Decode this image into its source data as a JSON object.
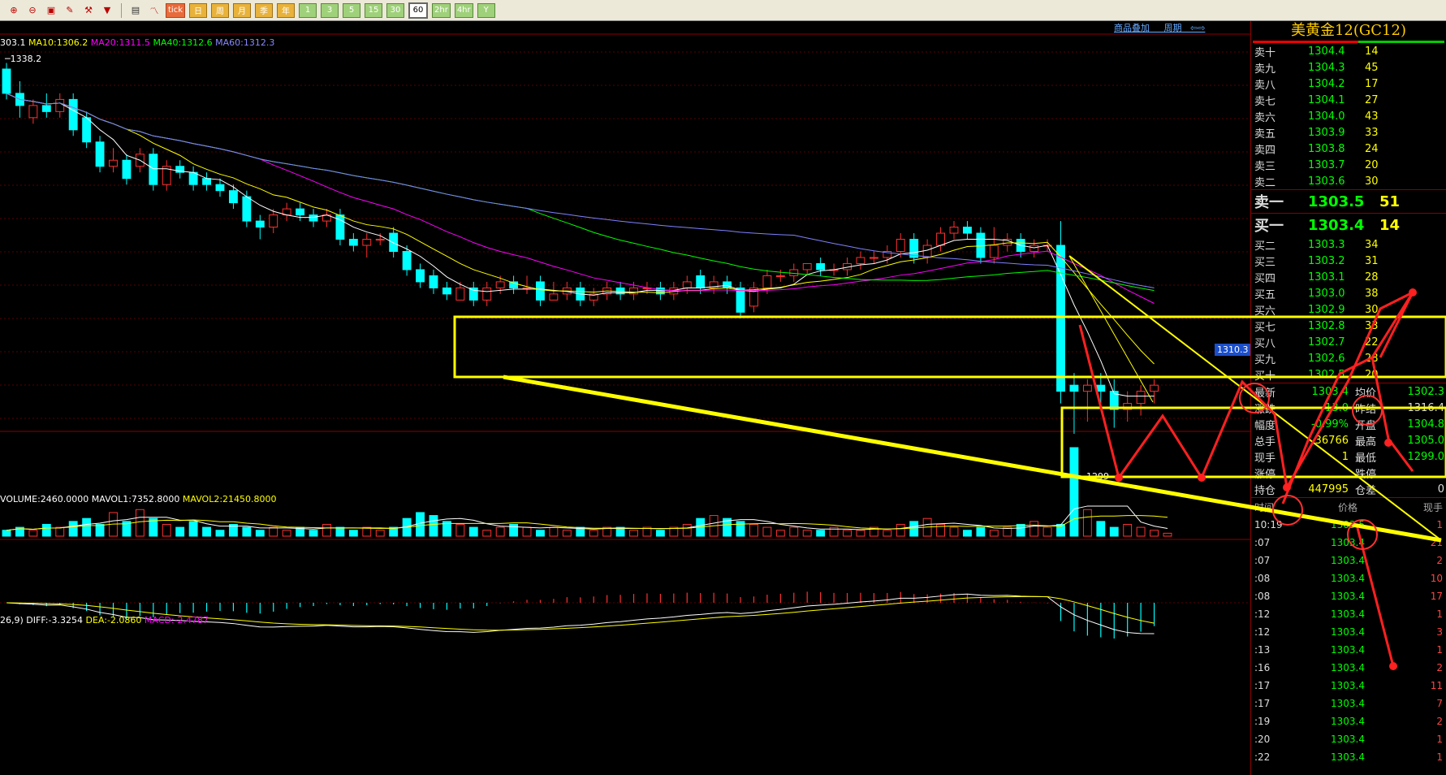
{
  "toolbar": {
    "buttons": [
      "1",
      "3",
      "5",
      "15",
      "30",
      "60",
      "2hr",
      "4hr",
      "Y"
    ],
    "active": "60",
    "icons": [
      "zoom-in-icon",
      "zoom-out-icon",
      "window-icon",
      "pencil-icon",
      "tools-icon",
      "filter-icon",
      "table-icon",
      "line-chart-icon",
      "tick-icon",
      "day-icon",
      "week-icon",
      "month-icon",
      "season-icon",
      "year-icon"
    ],
    "small_btn_labels": [
      "tick",
      "日",
      "周",
      "月",
      "季",
      "年"
    ]
  },
  "chart": {
    "ma_line": {
      "prefix": "303.1",
      "ma10": "MA10:1306.2",
      "ma20": "MA20:1311.5",
      "ma40": "MA40:1312.6",
      "ma60": "MA60:1312.3"
    },
    "high_label": "1338.2",
    "low_label": "1299",
    "links": [
      "商品叠加",
      "周期"
    ],
    "current_price_tag": "1310.3",
    "volume_line": {
      "volume": "VOLUME:2460.0000",
      "mavol1": "MAVOL1:7352.8000",
      "mavol2": "MAVOL2:21450.8000"
    },
    "macd_line": {
      "params": "26,9)",
      "diff": "DIFF:-3.3254",
      "dea": "DEA:-2.0860",
      "macd": "MACD:-2.4787"
    },
    "colors": {
      "up": "#ff3030",
      "down": "#00ffff",
      "ma5": "#ffffff",
      "ma10": "#ffff00",
      "ma20": "#ff00ff",
      "ma40": "#00ff00",
      "ma60": "#8080ff"
    }
  },
  "chart_data": {
    "type": "candlestick",
    "price_range": [
      1295,
      1340
    ],
    "candles": [
      {
        "o": 1338,
        "c": 1334,
        "h": 1339,
        "l": 1333
      },
      {
        "o": 1334,
        "c": 1332,
        "h": 1336,
        "l": 1330
      },
      {
        "o": 1330,
        "c": 1332,
        "h": 1333,
        "l": 1329
      },
      {
        "o": 1332,
        "c": 1331,
        "h": 1334,
        "l": 1330
      },
      {
        "o": 1331,
        "c": 1333,
        "h": 1334,
        "l": 1330
      },
      {
        "o": 1333,
        "c": 1328,
        "h": 1334,
        "l": 1327
      },
      {
        "o": 1330,
        "c": 1326,
        "h": 1331,
        "l": 1325
      },
      {
        "o": 1326,
        "c": 1322,
        "h": 1327,
        "l": 1321
      },
      {
        "o": 1322,
        "c": 1323,
        "h": 1325,
        "l": 1321
      },
      {
        "o": 1323,
        "c": 1320,
        "h": 1324,
        "l": 1319
      },
      {
        "o": 1322,
        "c": 1324,
        "h": 1325,
        "l": 1321
      },
      {
        "o": 1324,
        "c": 1319,
        "h": 1325,
        "l": 1318
      },
      {
        "o": 1319,
        "c": 1322,
        "h": 1323,
        "l": 1318
      },
      {
        "o": 1322,
        "c": 1321,
        "h": 1323,
        "l": 1320
      },
      {
        "o": 1321,
        "c": 1319,
        "h": 1322,
        "l": 1318
      },
      {
        "o": 1320,
        "c": 1319,
        "h": 1321,
        "l": 1318
      },
      {
        "o": 1319,
        "c": 1318,
        "h": 1320,
        "l": 1317
      },
      {
        "o": 1318,
        "c": 1316,
        "h": 1319,
        "l": 1315
      },
      {
        "o": 1317,
        "c": 1313,
        "h": 1318,
        "l": 1312
      },
      {
        "o": 1313,
        "c": 1312,
        "h": 1314,
        "l": 1310
      },
      {
        "o": 1312,
        "c": 1314,
        "h": 1315,
        "l": 1311
      },
      {
        "o": 1314,
        "c": 1315,
        "h": 1316,
        "l": 1313
      },
      {
        "o": 1315,
        "c": 1314,
        "h": 1316,
        "l": 1313
      },
      {
        "o": 1314,
        "c": 1313,
        "h": 1315,
        "l": 1312
      },
      {
        "o": 1313,
        "c": 1314,
        "h": 1315,
        "l": 1312
      },
      {
        "o": 1314,
        "c": 1310,
        "h": 1315,
        "l": 1309
      },
      {
        "o": 1310,
        "c": 1309,
        "h": 1311,
        "l": 1308
      },
      {
        "o": 1309,
        "c": 1310,
        "h": 1311,
        "l": 1307
      },
      {
        "o": 1310,
        "c": 1310,
        "h": 1311,
        "l": 1309
      },
      {
        "o": 1311,
        "c": 1308,
        "h": 1312,
        "l": 1307
      },
      {
        "o": 1308,
        "c": 1305,
        "h": 1309,
        "l": 1304
      },
      {
        "o": 1305,
        "c": 1303,
        "h": 1306,
        "l": 1302
      },
      {
        "o": 1304,
        "c": 1302,
        "h": 1305,
        "l": 1301
      },
      {
        "o": 1302,
        "c": 1301,
        "h": 1303,
        "l": 1300
      },
      {
        "o": 1300,
        "c": 1302,
        "h": 1303,
        "l": 1300
      },
      {
        "o": 1302,
        "c": 1300,
        "h": 1303,
        "l": 1299
      },
      {
        "o": 1300,
        "c": 1302,
        "h": 1303,
        "l": 1299
      },
      {
        "o": 1302,
        "c": 1303,
        "h": 1304,
        "l": 1301
      },
      {
        "o": 1303,
        "c": 1302,
        "h": 1304,
        "l": 1301
      },
      {
        "o": 1302,
        "c": 1302,
        "h": 1304,
        "l": 1301
      },
      {
        "o": 1303,
        "c": 1300,
        "h": 1304,
        "l": 1299
      },
      {
        "o": 1300,
        "c": 1301,
        "h": 1303,
        "l": 1300
      },
      {
        "o": 1301,
        "c": 1302,
        "h": 1303,
        "l": 1300
      },
      {
        "o": 1302,
        "c": 1300,
        "h": 1303,
        "l": 1299
      },
      {
        "o": 1300,
        "c": 1301,
        "h": 1302,
        "l": 1299
      },
      {
        "o": 1301,
        "c": 1302,
        "h": 1303,
        "l": 1300
      },
      {
        "o": 1302,
        "c": 1301,
        "h": 1303,
        "l": 1300
      },
      {
        "o": 1301,
        "c": 1302,
        "h": 1303,
        "l": 1300
      },
      {
        "o": 1302,
        "c": 1302,
        "h": 1303,
        "l": 1301
      },
      {
        "o": 1302,
        "c": 1301,
        "h": 1303,
        "l": 1300
      },
      {
        "o": 1301,
        "c": 1302,
        "h": 1303,
        "l": 1300
      },
      {
        "o": 1302,
        "c": 1303,
        "h": 1304,
        "l": 1301
      },
      {
        "o": 1304,
        "c": 1302,
        "h": 1305,
        "l": 1301
      },
      {
        "o": 1302,
        "c": 1303,
        "h": 1304,
        "l": 1301
      },
      {
        "o": 1303,
        "c": 1302,
        "h": 1304,
        "l": 1301
      },
      {
        "o": 1302,
        "c": 1298,
        "h": 1303,
        "l": 1297
      },
      {
        "o": 1299,
        "c": 1302,
        "h": 1303,
        "l": 1298
      },
      {
        "o": 1302,
        "c": 1304,
        "h": 1305,
        "l": 1301
      },
      {
        "o": 1304,
        "c": 1304,
        "h": 1305,
        "l": 1303
      },
      {
        "o": 1304,
        "c": 1305,
        "h": 1306,
        "l": 1303
      },
      {
        "o": 1305,
        "c": 1306,
        "h": 1306,
        "l": 1304
      },
      {
        "o": 1306,
        "c": 1305,
        "h": 1307,
        "l": 1304
      },
      {
        "o": 1305,
        "c": 1305,
        "h": 1306,
        "l": 1304
      },
      {
        "o": 1305,
        "c": 1306,
        "h": 1307,
        "l": 1304
      },
      {
        "o": 1306,
        "c": 1307,
        "h": 1308,
        "l": 1305
      },
      {
        "o": 1307,
        "c": 1307,
        "h": 1308,
        "l": 1306
      },
      {
        "o": 1307,
        "c": 1308,
        "h": 1309,
        "l": 1306
      },
      {
        "o": 1308,
        "c": 1310,
        "h": 1311,
        "l": 1307
      },
      {
        "o": 1310,
        "c": 1307,
        "h": 1311,
        "l": 1306
      },
      {
        "o": 1307,
        "c": 1309,
        "h": 1310,
        "l": 1306
      },
      {
        "o": 1309,
        "c": 1311,
        "h": 1312,
        "l": 1308
      },
      {
        "o": 1311,
        "c": 1312,
        "h": 1313,
        "l": 1310
      },
      {
        "o": 1312,
        "c": 1311,
        "h": 1313,
        "l": 1310
      },
      {
        "o": 1311,
        "c": 1307,
        "h": 1312,
        "l": 1306
      },
      {
        "o": 1307,
        "c": 1309,
        "h": 1312,
        "l": 1306
      },
      {
        "o": 1309,
        "c": 1310,
        "h": 1311,
        "l": 1308
      },
      {
        "o": 1310,
        "c": 1308,
        "h": 1311,
        "l": 1307
      },
      {
        "o": 1308,
        "c": 1309,
        "h": 1310,
        "l": 1307
      },
      {
        "o": 1309,
        "c": 1309,
        "h": 1310,
        "l": 1308
      },
      {
        "o": 1309,
        "c": 1285,
        "h": 1313,
        "l": 1283
      },
      {
        "o": 1286,
        "c": 1285,
        "h": 1288,
        "l": 1278
      },
      {
        "o": 1285,
        "c": 1286,
        "h": 1287,
        "l": 1280
      },
      {
        "o": 1286,
        "c": 1285,
        "h": 1288,
        "l": 1283
      },
      {
        "o": 1285,
        "c": 1282,
        "h": 1287,
        "l": 1279
      },
      {
        "o": 1282,
        "c": 1283,
        "h": 1285,
        "l": 1280
      },
      {
        "o": 1283,
        "c": 1285,
        "h": 1286,
        "l": 1281
      },
      {
        "o": 1285,
        "c": 1286,
        "h": 1287,
        "l": 1283
      }
    ],
    "volume": [
      2,
      3,
      2,
      4,
      3,
      5,
      6,
      4,
      8,
      5,
      9,
      6,
      4,
      3,
      5,
      3,
      2,
      4,
      3,
      2,
      3,
      2,
      3,
      2,
      4,
      3,
      2,
      3,
      2,
      3,
      6,
      8,
      7,
      5,
      4,
      3,
      2,
      3,
      4,
      3,
      2,
      3,
      2,
      3,
      2,
      3,
      3,
      2,
      3,
      2,
      3,
      4,
      6,
      7,
      6,
      5,
      4,
      3,
      2,
      3,
      2,
      2,
      3,
      2,
      2,
      3,
      2,
      4,
      5,
      6,
      4,
      3,
      2,
      3,
      2,
      3,
      4,
      5,
      3,
      4,
      30,
      9,
      5,
      3,
      4,
      3,
      2,
      1
    ]
  },
  "order_book": {
    "title": "美黄金12(GC12)",
    "asks": [
      {
        "label": "卖十",
        "price": "1304.4",
        "vol": "14"
      },
      {
        "label": "卖九",
        "price": "1304.3",
        "vol": "45"
      },
      {
        "label": "卖八",
        "price": "1304.2",
        "vol": "17"
      },
      {
        "label": "卖七",
        "price": "1304.1",
        "vol": "27"
      },
      {
        "label": "卖六",
        "price": "1304.0",
        "vol": "43"
      },
      {
        "label": "卖五",
        "price": "1303.9",
        "vol": "33"
      },
      {
        "label": "卖四",
        "price": "1303.8",
        "vol": "24"
      },
      {
        "label": "卖三",
        "price": "1303.7",
        "vol": "20"
      },
      {
        "label": "卖二",
        "price": "1303.6",
        "vol": "30"
      }
    ],
    "ask1": {
      "label": "卖一",
      "price": "1303.5",
      "vol": "51"
    },
    "bid1": {
      "label": "买一",
      "price": "1303.4",
      "vol": "14"
    },
    "bids": [
      {
        "label": "买二",
        "price": "1303.3",
        "vol": "34"
      },
      {
        "label": "买三",
        "price": "1303.2",
        "vol": "31"
      },
      {
        "label": "买四",
        "price": "1303.1",
        "vol": "28"
      },
      {
        "label": "买五",
        "price": "1303.0",
        "vol": "38"
      },
      {
        "label": "买六",
        "price": "1302.9",
        "vol": "30"
      },
      {
        "label": "买七",
        "price": "1302.8",
        "vol": "33"
      },
      {
        "label": "买八",
        "price": "1302.7",
        "vol": "22"
      },
      {
        "label": "买九",
        "price": "1302.6",
        "vol": "28"
      },
      {
        "label": "买十",
        "price": "1302.5",
        "vol": "20"
      }
    ]
  },
  "stats": {
    "latest_label": "最新",
    "latest": "1303.4",
    "avg_label": "均价",
    "avg": "1302.3",
    "change_label": "涨跌",
    "change": "-13.0",
    "prev_label": "昨结",
    "prev": "1316.4",
    "pct_label": "幅度",
    "pct": "-0.99%",
    "open_label": "开盘",
    "open": "1304.8",
    "total_label": "总手",
    "total": "36766",
    "high_label": "最高",
    "high": "1305.0",
    "now_label": "现手",
    "now": "1",
    "low_label": "最低",
    "low": "1299.0",
    "limit_label": "涨停",
    "limit": "",
    "limitdown_label": "跌停",
    "limitdown": "",
    "oi_label": "持仓",
    "oi": "447995",
    "oichg_label": "仓差",
    "oichg": "0"
  },
  "ticks": {
    "headers": {
      "time": "时间",
      "price": "价格",
      "vol": "现手"
    },
    "rows": [
      {
        "t": "10:19",
        "p": "1303.5",
        "v": "1"
      },
      {
        "t": ":07",
        "p": "1303.4",
        "v": "21"
      },
      {
        "t": ":07",
        "p": "1303.4",
        "v": "2"
      },
      {
        "t": ":08",
        "p": "1303.4",
        "v": "10"
      },
      {
        "t": ":08",
        "p": "1303.4",
        "v": "17"
      },
      {
        "t": ":12",
        "p": "1303.4",
        "v": "1"
      },
      {
        "t": ":12",
        "p": "1303.4",
        "v": "3"
      },
      {
        "t": ":13",
        "p": "1303.4",
        "v": "1"
      },
      {
        "t": ":16",
        "p": "1303.4",
        "v": "2"
      },
      {
        "t": ":17",
        "p": "1303.4",
        "v": "11"
      },
      {
        "t": ":17",
        "p": "1303.4",
        "v": "7"
      },
      {
        "t": ":19",
        "p": "1303.4",
        "v": "2"
      },
      {
        "t": ":20",
        "p": "1303.4",
        "v": "1"
      },
      {
        "t": ":22",
        "p": "1303.4",
        "v": "1"
      }
    ]
  }
}
